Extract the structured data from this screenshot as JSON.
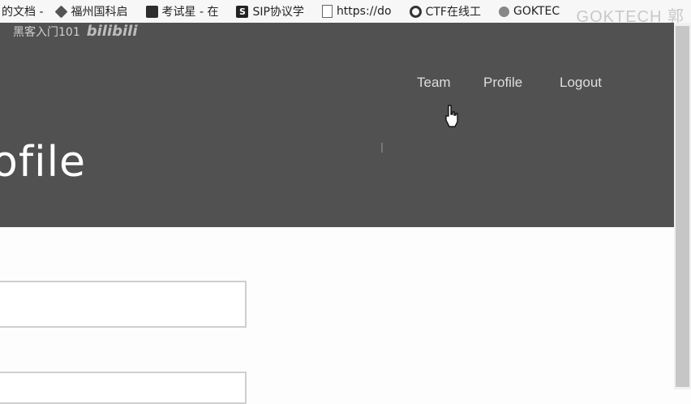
{
  "bookmarks": [
    {
      "label": "的文档 -",
      "icon": "document-icon"
    },
    {
      "label": "福州国科启",
      "icon": "diamond-icon"
    },
    {
      "label": "考试星 - 在",
      "icon": "tool-icon"
    },
    {
      "label": "SIP协议学",
      "icon": "s-logo-icon"
    },
    {
      "label": "https://do",
      "icon": "file-icon"
    },
    {
      "label": "CTF在线工",
      "icon": "circle-logo-icon"
    },
    {
      "label": "GOKTEC",
      "icon": "gok-icon"
    }
  ],
  "watermark": "GOKTECH 郭",
  "overlay": {
    "text": "黑客入门101",
    "logo": "bilibili"
  },
  "nav": {
    "team": "Team",
    "profile": "Profile",
    "logout": "Logout"
  },
  "page": {
    "title": "ofile"
  },
  "form": {
    "field1": {
      "value": "",
      "placeholder": ""
    },
    "field2": {
      "value": "",
      "placeholder": ""
    }
  }
}
